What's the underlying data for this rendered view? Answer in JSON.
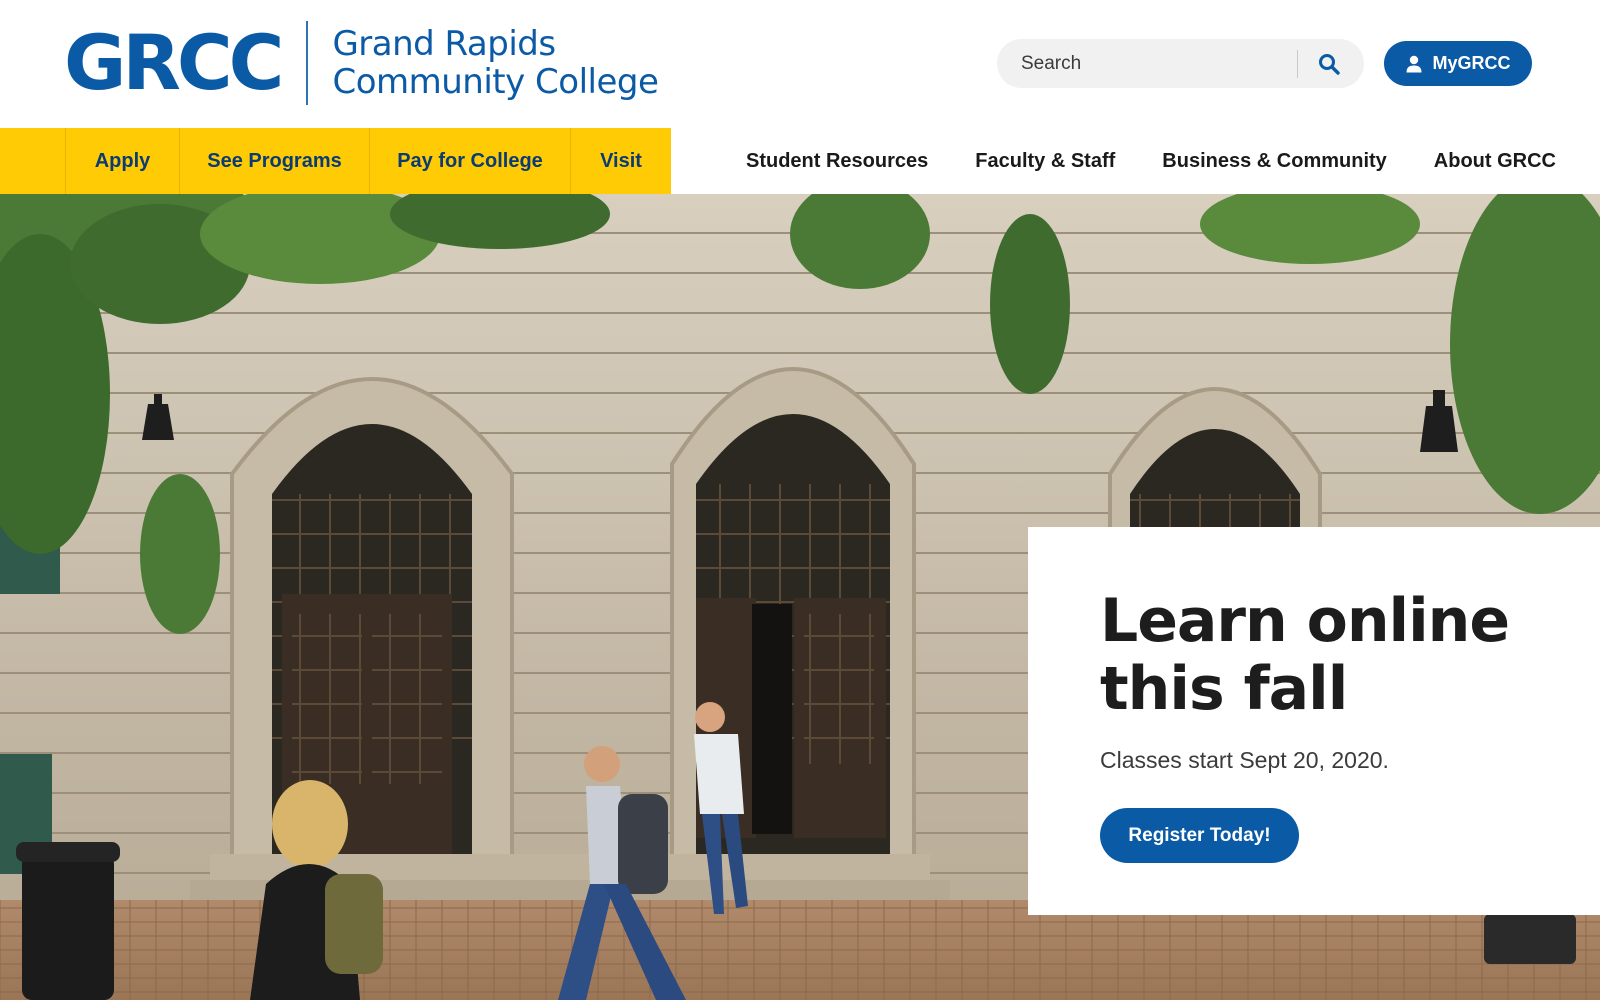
{
  "brand": {
    "mark": "GRCC",
    "name_line1": "Grand Rapids",
    "name_line2": "Community College",
    "primary_color": "#0b5aa6",
    "accent_color": "#ffcb05"
  },
  "search": {
    "placeholder": "Search",
    "value": "",
    "icon": "search-icon"
  },
  "account": {
    "label": "MyGRCC",
    "icon": "user-icon"
  },
  "primary_nav": [
    {
      "label": "Apply"
    },
    {
      "label": "See Programs"
    },
    {
      "label": "Pay for College"
    },
    {
      "label": "Visit"
    }
  ],
  "secondary_nav": [
    {
      "label": "Student Resources"
    },
    {
      "label": "Faculty & Staff"
    },
    {
      "label": "Business & Community"
    },
    {
      "label": "About GRCC"
    }
  ],
  "hero": {
    "headline": "Learn online this fall",
    "subtext": "Classes start Sept 20, 2020.",
    "cta_label": "Register Today!"
  }
}
